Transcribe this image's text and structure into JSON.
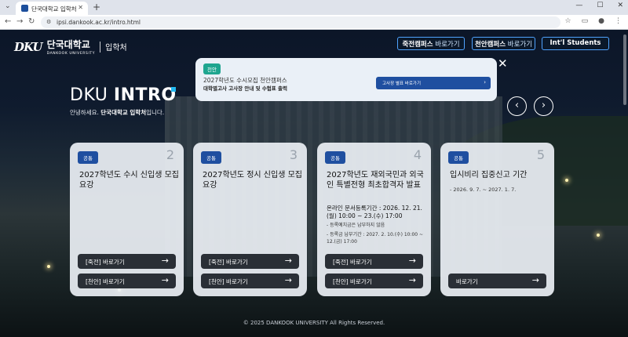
{
  "browser": {
    "tab_title": "단국대학교 입학처",
    "url": "ipsi.dankook.ac.kr/intro.html"
  },
  "header": {
    "logo_mark": "DKU",
    "logo_korean": "단국대학교",
    "logo_english": "DANKOOK UNIVERSITY",
    "admission": "입학처",
    "btn_jukjeon_a": "죽전캠퍼스",
    "btn_jukjeon_b": " 바로가기",
    "btn_cheonan_a": "천안캠퍼스",
    "btn_cheonan_b": " 바로가기",
    "btn_intl": "Int'l Students"
  },
  "popup": {
    "badge": "천안",
    "line1": "2027학년도 수시모집 천안캠퍼스",
    "line2": "대학별고사 고사장 안내 및 수험표 출력",
    "button": "고사장 별표 바로가기"
  },
  "intro": {
    "title_a": "DKU",
    "title_b": "INTRO",
    "sub_a": "안녕하세요. ",
    "sub_b": "단국대학교 입학처",
    "sub_c": "입니다."
  },
  "cards": [
    {
      "badge": "공통",
      "num": "2",
      "title": "2027학년도 수시 신입생 모집요강",
      "btn1": "[죽전] 바로가기",
      "btn2": "[천안] 바로가기"
    },
    {
      "badge": "공통",
      "num": "3",
      "title": "2027학년도 정시 신입생 모집요강",
      "btn1": "[죽전] 바로가기",
      "btn2": "[천안] 바로가기"
    },
    {
      "badge": "공통",
      "num": "4",
      "title": "2027학년도 재외국민과 외국인 특별전형 최초합격자 발표",
      "body1": "온라인 문서등록기간 : 2026. 12. 21.(월) 10:00 ~ 23.(수) 17:00",
      "body2": "- 등록예치금은 납부하지 않음",
      "body3": "- 등록금 납부기간 : 2027. 2. 10.(수) 10:00 ~ 12.(금) 17:00",
      "btn1": "[죽전] 바로가기",
      "btn2": "[천안] 바로가기"
    },
    {
      "badge": "공통",
      "num": "5",
      "title": "입시비리 집중신고 기간",
      "body1": "- 2026. 9. 7. ~ 2027. 1. 7.",
      "btn1": "바로가기"
    }
  ],
  "footer": "© 2025 DANKOOK UNIVERSITY All Rights Reserved.",
  "icons": {
    "arrow": "→",
    "chevron_left": "‹",
    "chevron_right": "›",
    "close": "✕"
  }
}
